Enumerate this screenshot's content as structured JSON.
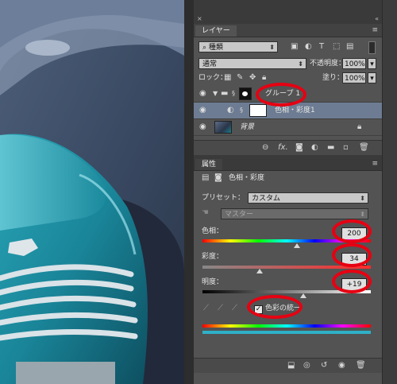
{
  "layers_panel": {
    "tab_label": "レイヤー",
    "kind_filter": "種類",
    "blend_mode": "通常",
    "opacity_label": "不透明度：",
    "opacity_value": "100%",
    "lock_label": "ロック：",
    "fill_label": "塗り：",
    "fill_value": "100%",
    "layers": [
      {
        "name": "グループ 1",
        "type": "group"
      },
      {
        "name": "色相・彩度1",
        "type": "adjustment"
      },
      {
        "name": "背景",
        "type": "background"
      }
    ]
  },
  "properties_panel": {
    "tab_label": "属性",
    "title": "色相・彩度",
    "preset_label": "プリセット：",
    "preset_value": "カスタム",
    "channel_value": "マスター",
    "hue_label": "色相：",
    "hue_value": "200",
    "saturation_label": "彩度：",
    "saturation_value": "34",
    "lightness_label": "明度：",
    "lightness_value": "+19",
    "colorize_label": "色彩の統一",
    "colorize_checked": true,
    "hue_slider_fraction": 0.56,
    "saturation_slider_fraction": 0.34,
    "lightness_slider_fraction": 0.6
  },
  "highlight_color": "#e60012"
}
